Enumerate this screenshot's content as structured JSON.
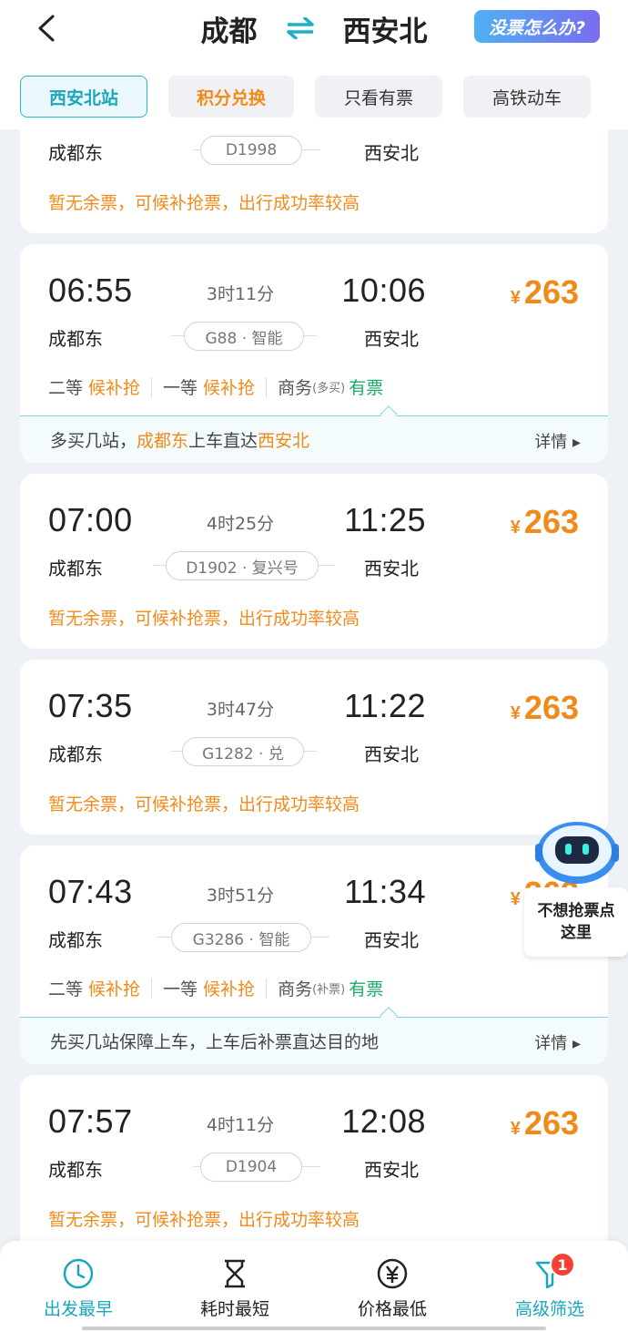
{
  "header": {
    "from": "成都",
    "to": "西安北",
    "help_label": "没票怎么办?"
  },
  "filters": [
    {
      "label": "西安北站",
      "active": true
    },
    {
      "label": "积分兑换",
      "active": false
    },
    {
      "label": "只看有票",
      "active": false
    },
    {
      "label": "高铁动车",
      "active": false
    }
  ],
  "trains": [
    {
      "dep_station": "成都东",
      "arr_station": "西安北",
      "train": "D1998",
      "waitlist_msg": "暂无余票，可候补抢票，出行成功率较高"
    },
    {
      "dep_time": "06:55",
      "arr_time": "10:06",
      "duration": "3时11分",
      "price": "263",
      "dep_station": "成都东",
      "arr_station": "西安北",
      "train": "G88 · 智能",
      "seats": {
        "s2_label": "二等",
        "s2_status": "候补抢",
        "s1_label": "一等",
        "s1_status": "候补抢",
        "biz_label": "商务",
        "biz_note": "(多买)",
        "biz_status": "有票"
      },
      "tip": {
        "prefix": "多买几站，",
        "from": "成都东",
        "mid": "上车直达",
        "to": "西安北",
        "detail": "详情 ▸"
      }
    },
    {
      "dep_time": "07:00",
      "arr_time": "11:25",
      "duration": "4时25分",
      "price": "263",
      "dep_station": "成都东",
      "arr_station": "西安北",
      "train": "D1902 · 复兴号",
      "waitlist_msg": "暂无余票，可候补抢票，出行成功率较高"
    },
    {
      "dep_time": "07:35",
      "arr_time": "11:22",
      "duration": "3时47分",
      "price": "263",
      "dep_station": "成都东",
      "arr_station": "西安北",
      "train": "G1282 · 兑",
      "waitlist_msg": "暂无余票，可候补抢票，出行成功率较高"
    },
    {
      "dep_time": "07:43",
      "arr_time": "11:34",
      "duration": "3时51分",
      "price": "263",
      "dep_station": "成都东",
      "arr_station": "西安北",
      "train": "G3286 · 智能",
      "seats": {
        "s2_label": "二等",
        "s2_status": "候补抢",
        "s1_label": "一等",
        "s1_status": "候补抢",
        "biz_label": "商务",
        "biz_note": "(补票)",
        "biz_status": "有票"
      },
      "tip": {
        "text": "先买几站保障上车，上车后补票直达目的地",
        "detail": "详情 ▸"
      }
    },
    {
      "dep_time": "07:57",
      "arr_time": "12:08",
      "duration": "4时11分",
      "price": "263",
      "dep_station": "成都东",
      "arr_station": "西安北",
      "train": "D1904",
      "waitlist_msg": "暂无余票，可候补抢票，出行成功率较高"
    }
  ],
  "currency": "¥",
  "robot_tip": {
    "line1": "不想抢票点",
    "line2": "这里"
  },
  "bottom_tabs": [
    {
      "label": "出发最早",
      "icon": "clock-icon",
      "active": true
    },
    {
      "label": "耗时最短",
      "icon": "hourglass-icon",
      "active": false
    },
    {
      "label": "价格最低",
      "icon": "yen-circle-icon",
      "active": false
    },
    {
      "label": "高级筛选",
      "icon": "filter-icon",
      "active": true,
      "badge": "1"
    }
  ],
  "colors": {
    "accent": "#1aa6bb",
    "price": "#f08a1a",
    "available": "#1aaa66"
  }
}
